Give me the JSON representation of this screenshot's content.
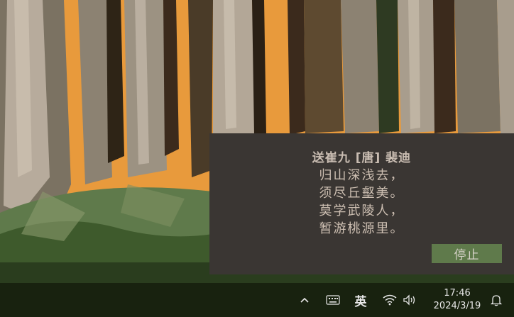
{
  "popup": {
    "title": "送崔九  [唐] 裴迪",
    "lines": [
      "归山深浅去，",
      "须尽丘壑美。",
      "莫学武陵人，",
      "暂游桃源里。"
    ],
    "stop_label": "停止"
  },
  "taskbar": {
    "ime_label": "英",
    "time": "17:46",
    "date": "2024/3/19"
  },
  "icons": {
    "chevron": "chevron-up-icon",
    "keyboard": "keyboard-icon",
    "wifi": "wifi-icon",
    "volume": "volume-icon",
    "notification": "bell-icon"
  },
  "colors": {
    "popup_bg": "#3a3633",
    "button_bg": "#5f7a4b",
    "taskbar_bg": "#18220f",
    "wallpaper_orange": "#e89a3c"
  }
}
